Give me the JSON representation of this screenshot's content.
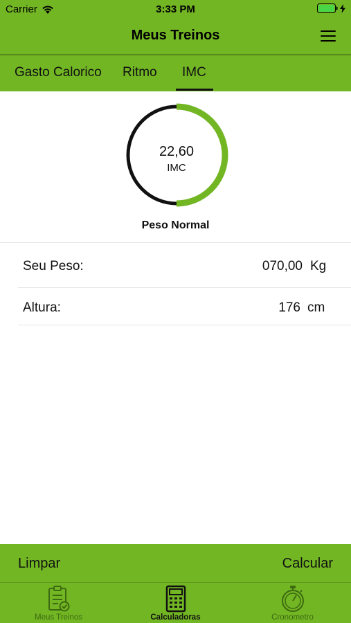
{
  "status_bar": {
    "carrier": "Carrier",
    "time": "3:33 PM"
  },
  "header": {
    "title": "Meus Treinos",
    "menu_icon": "hamburger-menu-icon"
  },
  "tabs": [
    {
      "label": "Gasto Calorico",
      "active": false
    },
    {
      "label": "Ritmo",
      "active": false
    },
    {
      "label": "IMC",
      "active": true
    }
  ],
  "gauge": {
    "value": "22,60",
    "unit": "IMC",
    "progress": 0.5,
    "status": "Peso Normal"
  },
  "form": {
    "weight": {
      "label": "Seu Peso:",
      "value": "070,00",
      "unit": "Kg"
    },
    "height": {
      "label": "Altura:",
      "value": "176",
      "unit": "cm"
    }
  },
  "actions": {
    "clear_label": "Limpar",
    "calculate_label": "Calcular"
  },
  "tab_bar": [
    {
      "label": "Meus Treinos",
      "icon": "clipboard-check-icon",
      "active": false
    },
    {
      "label": "Calculadoras",
      "icon": "calculator-icon",
      "active": true
    },
    {
      "label": "Cronometro",
      "icon": "stopwatch-icon",
      "active": false
    }
  ],
  "colors": {
    "accent": "#72b624",
    "gauge_track": "#111111",
    "inactive_tab": "#3d6a10"
  }
}
